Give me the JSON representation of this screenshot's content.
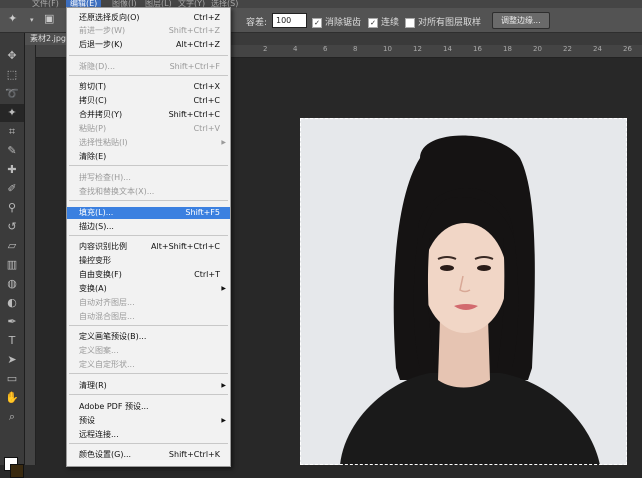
{
  "menubar": {
    "items": [
      "文件(F)",
      "编辑(E)",
      "图像(I)",
      "图层(L)",
      "文字(Y)",
      "选择(S)"
    ]
  },
  "options": {
    "tolerance_label": "容差:",
    "tolerance_value": "100",
    "antialias_label": "消除锯齿",
    "contiguous_label": "连续",
    "sample_all_label": "对所有图层取样",
    "refine_edge_button": "调整边缘..."
  },
  "document": {
    "tab": "素材2.jpg"
  },
  "ruler": [
    "2",
    "4",
    "6",
    "8",
    "10",
    "12",
    "14",
    "16",
    "18",
    "20",
    "22",
    "24",
    "26"
  ],
  "edit_menu": {
    "items": [
      {
        "label": "还原选择反向(O)",
        "shortcut": "Ctrl+Z",
        "disabled": false
      },
      {
        "label": "前进一步(W)",
        "shortcut": "Shift+Ctrl+Z",
        "disabled": true
      },
      {
        "label": "后退一步(K)",
        "shortcut": "Alt+Ctrl+Z",
        "disabled": false
      },
      {
        "label": "渐隐(D)...",
        "shortcut": "Shift+Ctrl+F",
        "disabled": true
      },
      {
        "label": "剪切(T)",
        "shortcut": "Ctrl+X",
        "disabled": false
      },
      {
        "label": "拷贝(C)",
        "shortcut": "Ctrl+C",
        "disabled": false
      },
      {
        "label": "合并拷贝(Y)",
        "shortcut": "Shift+Ctrl+C",
        "disabled": false
      },
      {
        "label": "粘贴(P)",
        "shortcut": "Ctrl+V",
        "disabled": true
      },
      {
        "label": "选择性粘贴(I)",
        "shortcut": "",
        "disabled": true,
        "submenu": true
      },
      {
        "label": "清除(E)",
        "shortcut": "",
        "disabled": false
      },
      {
        "label": "拼写检查(H)...",
        "shortcut": "",
        "disabled": true
      },
      {
        "label": "查找和替换文本(X)...",
        "shortcut": "",
        "disabled": true
      },
      {
        "label": "填充(L)...",
        "shortcut": "Shift+F5",
        "disabled": false,
        "highlighted": true
      },
      {
        "label": "描边(S)...",
        "shortcut": "",
        "disabled": false
      },
      {
        "label": "内容识别比例",
        "shortcut": "Alt+Shift+Ctrl+C",
        "disabled": false
      },
      {
        "label": "操控变形",
        "shortcut": "",
        "disabled": false
      },
      {
        "label": "自由变换(F)",
        "shortcut": "Ctrl+T",
        "disabled": false
      },
      {
        "label": "变换(A)",
        "shortcut": "",
        "disabled": false,
        "submenu": true
      },
      {
        "label": "自动对齐图层...",
        "shortcut": "",
        "disabled": true
      },
      {
        "label": "自动混合图层...",
        "shortcut": "",
        "disabled": true
      },
      {
        "label": "定义画笔预设(B)...",
        "shortcut": "",
        "disabled": false
      },
      {
        "label": "定义图案...",
        "shortcut": "",
        "disabled": true
      },
      {
        "label": "定义自定形状...",
        "shortcut": "",
        "disabled": true
      },
      {
        "label": "清理(R)",
        "shortcut": "",
        "disabled": false,
        "submenu": true
      },
      {
        "label": "Adobe PDF 预设...",
        "shortcut": "",
        "disabled": false
      },
      {
        "label": "预设",
        "shortcut": "",
        "disabled": false,
        "submenu": true
      },
      {
        "label": "远程连接...",
        "shortcut": "",
        "disabled": false
      },
      {
        "label": "颜色设置(G)...",
        "shortcut": "Shift+Ctrl+K",
        "disabled": false
      }
    ]
  },
  "tools": [
    "move-icon",
    "marquee-icon",
    "lasso-icon",
    "magic-wand-icon",
    "crop-icon",
    "eyedropper-icon",
    "healing-brush-icon",
    "brush-icon",
    "clone-stamp-icon",
    "history-brush-icon",
    "eraser-icon",
    "gradient-icon",
    "blur-icon",
    "dodge-icon",
    "pen-icon",
    "type-icon",
    "path-select-icon",
    "shape-icon",
    "hand-icon",
    "zoom-icon"
  ],
  "colors": {
    "highlight": "#3b80e0",
    "foreground": "#ffffff",
    "background": "#3a2a10"
  }
}
